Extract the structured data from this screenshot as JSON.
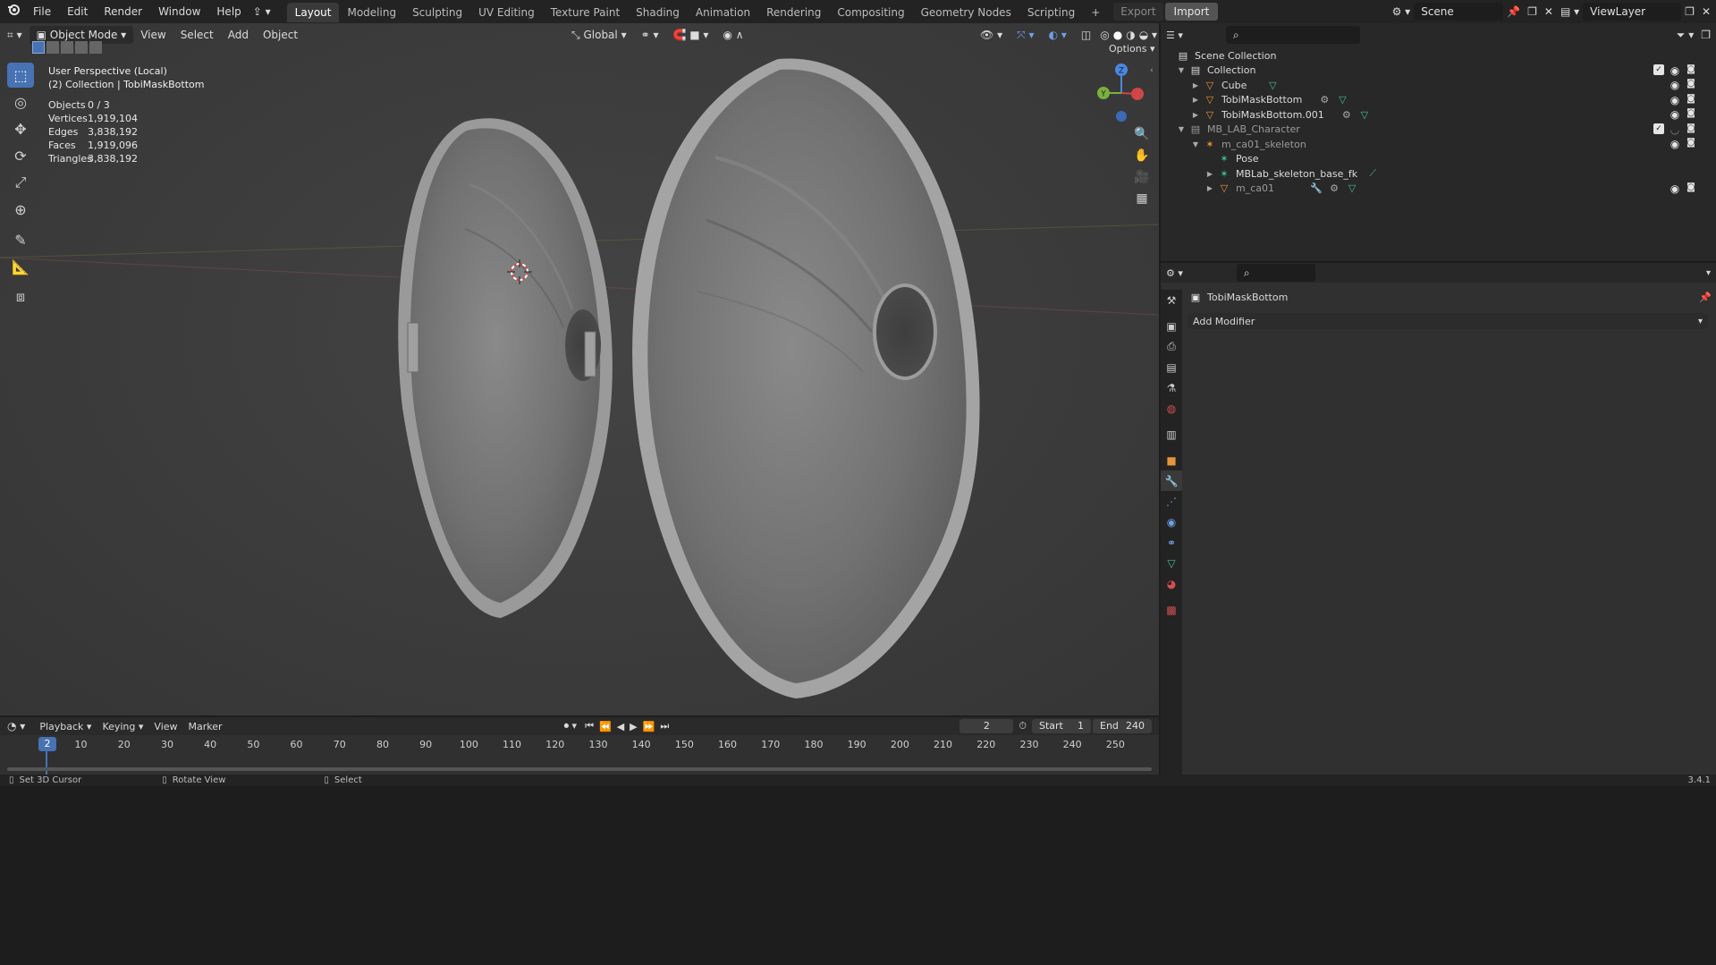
{
  "topbar": {
    "menus": [
      "File",
      "Edit",
      "Render",
      "Window",
      "Help"
    ],
    "workspaces": [
      "Layout",
      "Modeling",
      "Sculpting",
      "UV Editing",
      "Texture Paint",
      "Shading",
      "Animation",
      "Rendering",
      "Compositing",
      "Geometry Nodes",
      "Scripting"
    ],
    "active_workspace": "Layout",
    "export_label": "Export",
    "import_label": "Import",
    "scene_name": "Scene",
    "view_layer": "ViewLayer"
  },
  "viewport_header": {
    "mode": "Object Mode",
    "menus": [
      "View",
      "Select",
      "Add",
      "Object"
    ],
    "transform_orientation": "Global",
    "options_label": "Options"
  },
  "viewport_overlay": {
    "perspective": "User Perspective (Local)",
    "context": "(2) Collection | TobiMaskBottom",
    "stats": [
      {
        "label": "Objects",
        "value": "0 / 3"
      },
      {
        "label": "Vertices",
        "value": "1,919,104"
      },
      {
        "label": "Edges",
        "value": "3,838,192"
      },
      {
        "label": "Faces",
        "value": "1,919,096"
      },
      {
        "label": "Triangles",
        "value": "3,838,192"
      }
    ]
  },
  "gizmo": {
    "z": "Z",
    "y": "Y"
  },
  "outliner": {
    "rows": [
      {
        "name": "Scene Collection",
        "indent": 0,
        "icon": "scene-collection-icon"
      },
      {
        "name": "Collection",
        "indent": 1,
        "icon": "collection-icon"
      },
      {
        "name": "Cube",
        "indent": 2,
        "icon": "mesh-object-icon"
      },
      {
        "name": "TobiMaskBottom",
        "indent": 2,
        "icon": "mesh-object-icon"
      },
      {
        "name": "TobiMaskBottom.001",
        "indent": 2,
        "icon": "mesh-object-icon"
      },
      {
        "name": "MB_LAB_Character",
        "indent": 1,
        "icon": "collection-icon"
      },
      {
        "name": "m_ca01_skeleton",
        "indent": 2,
        "icon": "armature-icon"
      },
      {
        "name": "Pose",
        "indent": 3,
        "icon": "pose-icon"
      },
      {
        "name": "MBLab_skeleton_base_fk",
        "indent": 3,
        "icon": "armature-data-icon"
      },
      {
        "name": "m_ca01",
        "indent": 3,
        "icon": "mesh-object-icon"
      }
    ]
  },
  "properties": {
    "object_name": "TobiMaskBottom",
    "add_modifier": "Add Modifier"
  },
  "timeline": {
    "menus": [
      "Playback",
      "Keying",
      "View",
      "Marker"
    ],
    "current_frame": "2",
    "start_label": "Start",
    "start_value": "1",
    "end_label": "End",
    "end_value": "240",
    "ticks": [
      "2",
      "10",
      "20",
      "30",
      "40",
      "50",
      "60",
      "70",
      "80",
      "90",
      "100",
      "110",
      "120",
      "130",
      "140",
      "150",
      "160",
      "170",
      "180",
      "190",
      "200",
      "210",
      "220",
      "230",
      "240",
      "250"
    ]
  },
  "statusbar": {
    "left": "Set 3D Cursor",
    "middle": "Rotate View",
    "right": "Select",
    "version": "3.4.1"
  },
  "colors": {
    "accent": "#4772b3",
    "mesh_icon": "#e8943a",
    "data_icon": "#3ec28f"
  }
}
